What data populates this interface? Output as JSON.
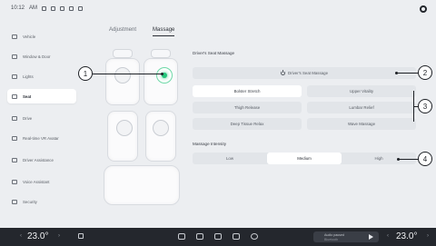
{
  "status": {
    "time": "10:12",
    "extra": "AM"
  },
  "sidebar": {
    "items": [
      {
        "label": "Vehicle",
        "icon": "car-icon",
        "active": false
      },
      {
        "label": "Window & Door",
        "icon": "door-icon",
        "active": false
      },
      {
        "label": "Lights",
        "icon": "light-icon",
        "active": false
      },
      {
        "label": "Seat",
        "icon": "seat-icon",
        "active": true
      },
      {
        "label": "Drive",
        "icon": "steering-icon",
        "active": false
      },
      {
        "label": "Real-time VR Avatar",
        "icon": "vr-icon",
        "active": false
      },
      {
        "label": "Driver Assistance",
        "icon": "assist-icon",
        "active": false
      },
      {
        "label": "Voice Assistant",
        "icon": "mic-icon",
        "active": false
      },
      {
        "label": "Security",
        "icon": "shield-icon",
        "active": false
      }
    ]
  },
  "tabs": [
    {
      "label": "Adjustment",
      "active": false
    },
    {
      "label": "Massage",
      "active": true
    }
  ],
  "massage": {
    "section_title": "Driver's Seat Massage",
    "power_label": "Driver's Seat Massage",
    "modes": [
      "Bolster Stretch",
      "Upper Vitality",
      "Thigh Release",
      "Lumbar Relief",
      "Deep Tissue Relax",
      "Wave Massage"
    ],
    "intensity_title": "Massage Intensity",
    "intensity_options": [
      "Low",
      "Medium",
      "High"
    ],
    "intensity_selected": "Medium"
  },
  "callouts": [
    "1",
    "2",
    "3",
    "4"
  ],
  "dock": {
    "temp_left": "23.0°",
    "temp_right": "23.0°",
    "media_title": "Audio paused",
    "media_sub": "Bluetooth"
  },
  "colors": {
    "accent": "#23c47a",
    "dock": "#24272d",
    "background": "#eceef1"
  }
}
